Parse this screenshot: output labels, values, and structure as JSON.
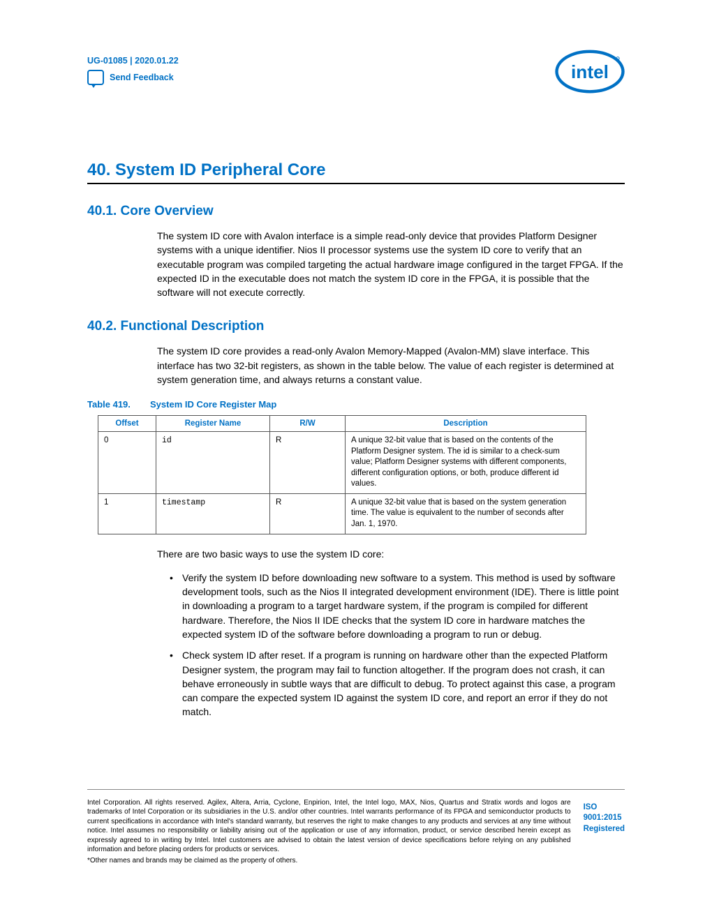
{
  "header": {
    "doc_id": "UG-01085 | 2020.01.22",
    "feedback": "Send Feedback",
    "logo_text": "intel"
  },
  "title": "40. System ID Peripheral Core",
  "s1": {
    "heading": "40.1. Core Overview",
    "p1": "The system ID core with Avalon interface is a simple read-only device that provides Platform Designer systems with a unique identifier. Nios II processor systems use the system ID core to verify that an executable program was compiled targeting the actual hardware image configured in the target FPGA. If the expected ID in the executable does not match the system ID core in the FPGA, it is possible that the software will not execute correctly."
  },
  "s2": {
    "heading": "40.2. Functional Description",
    "p1": "The system ID core provides a read-only Avalon Memory-Mapped (Avalon-MM) slave interface. This interface has two 32-bit registers, as shown in the table below. The value of each register is determined at system generation time, and always returns a constant value."
  },
  "table": {
    "num": "Table 419.",
    "title": "System ID Core Register Map",
    "headers": {
      "c0": "Offset",
      "c1": "Register Name",
      "c2": "R/W",
      "c3": "Description"
    },
    "rows": [
      {
        "offset": "0",
        "name": "id",
        "rw": "R",
        "desc": "A unique 32-bit value that is based on the contents of the Platform Designer system. The id is similar to a check-sum value; Platform Designer systems with different components, different configuration options, or both, produce different id values."
      },
      {
        "offset": "1",
        "name": "timestamp",
        "rw": "R",
        "desc": "A unique 32-bit value that is based on the system generation time. The value is equivalent to the number of seconds after Jan. 1, 1970."
      }
    ]
  },
  "after_table": "There are two basic ways to use the system ID core:",
  "bullets": [
    "Verify the system ID before downloading new software to a system. This method is used by software development tools, such as the Nios II integrated development environment (IDE). There is little point in downloading a program to a target hardware system, if the program is compiled for different hardware. Therefore, the Nios II IDE checks that the system ID core in hardware matches the expected system ID of the software before downloading a program to run or debug.",
    "Check system ID after reset. If a program is running on hardware other than the expected Platform Designer system, the program may fail to function altogether. If the program does not crash, it can behave erroneously in subtle ways that are difficult to debug. To protect against this case, a program can compare the expected system ID against the system ID core, and report an error if they do not match."
  ],
  "footer": {
    "legal": "Intel Corporation. All rights reserved. Agilex, Altera, Arria, Cyclone, Enpirion, Intel, the Intel logo, MAX, Nios, Quartus and Stratix words and logos are trademarks of Intel Corporation or its subsidiaries in the U.S. and/or other countries. Intel warrants performance of its FPGA and semiconductor products to current specifications in accordance with Intel's standard warranty, but reserves the right to make changes to any products and services at any time without notice. Intel assumes no responsibility or liability arising out of the application or use of any information, product, or service described herein except as expressly agreed to in writing by Intel. Intel customers are advised to obtain the latest version of device specifications before relying on any published information and before placing orders for products or services.",
    "other": "*Other names and brands may be claimed as the property of others.",
    "iso1": "ISO",
    "iso2": "9001:2015",
    "iso3": "Registered"
  }
}
